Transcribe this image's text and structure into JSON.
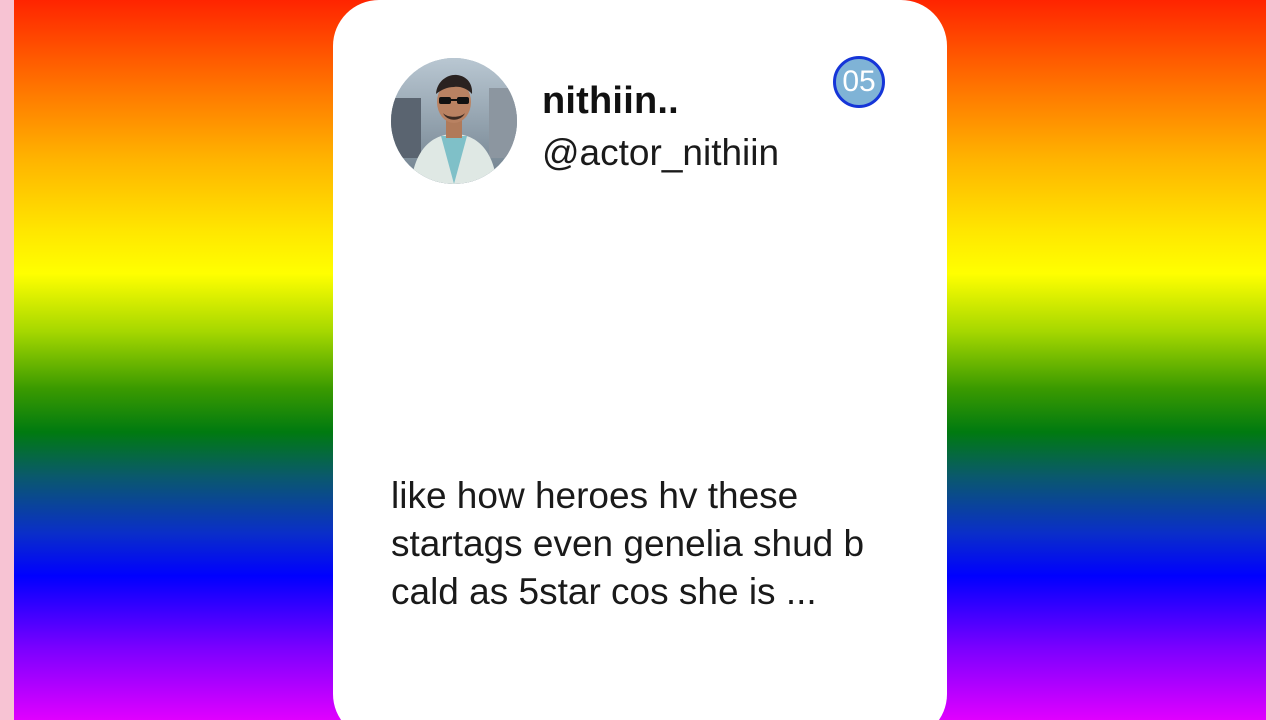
{
  "background": {
    "gradient_colors": [
      "#ff2400",
      "#ffb300",
      "#ffff00",
      "#007a10",
      "#0000ff",
      "#e000ff"
    ],
    "border_color": "#f7c3d3"
  },
  "card": {
    "user": {
      "display_name": "nithiin..",
      "handle": "@actor_nithiin",
      "avatar_icon": "profile-photo"
    },
    "badge": {
      "number": "05",
      "fill_color": "#7fb3d6",
      "ring_color": "#1535d8"
    },
    "tweet_text": "like how heroes hv these startags even genelia shud b cald as 5star cos she is ..."
  }
}
